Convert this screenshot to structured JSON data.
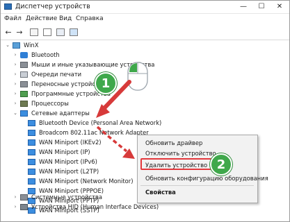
{
  "window": {
    "title": "Диспетчер устройств",
    "minimize": "—",
    "maximize": "☐",
    "close": "✕"
  },
  "menu": [
    "Файл",
    "Действие",
    "Вид",
    "Справка"
  ],
  "toolbar": {
    "back": "←",
    "forward": "→"
  },
  "tree": {
    "root": "WinX",
    "categories": [
      "Bluetooth",
      "Мыши и иные указывающие устройства",
      "Очереди печати",
      "Переносные устройства",
      "Программные устройства",
      "Процессоры",
      "Сетевые адаптеры"
    ],
    "adapters": [
      "Bluetooth Device (Personal Area Network)",
      "Broadcom 802.11ac Network Adapter",
      "WAN Miniport (IKEv2)",
      "WAN Miniport (IP)",
      "WAN Miniport (IPv6)",
      "WAN Miniport (L2TP)",
      "WAN Miniport (Network Monitor)",
      "WAN Miniport (PPPOE)",
      "WAN Miniport (PPTP)",
      "WAN Miniport (SSTP)"
    ],
    "after": [
      "Системные устройства",
      "Устройства HID (Human Interface Devices)"
    ],
    "expanded_glyph": "⌄",
    "collapsed_glyph": "›"
  },
  "context_menu": {
    "update": "Обновить драйвер",
    "disable": "Отключить устройство",
    "uninstall": "Удалить устройство",
    "scan": "Обновить конфигурацию оборудования",
    "properties": "Свойства"
  },
  "annotations": {
    "step1": "1",
    "step2": "2",
    "accent_green": "#3fa84b",
    "accent_red": "#e3383c"
  }
}
